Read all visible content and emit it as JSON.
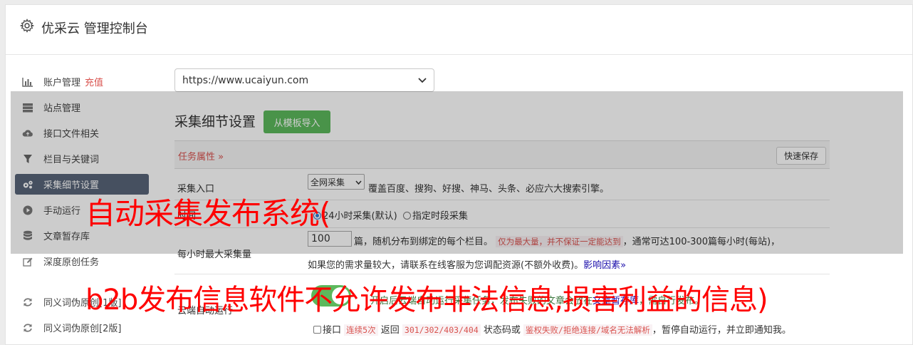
{
  "header": {
    "title": "优采云 管理控制台",
    "icon": "gear-icon"
  },
  "sidebar": {
    "items": [
      {
        "label": "账户管理",
        "extra": "充值",
        "icon": "bar-chart-icon"
      },
      {
        "label": "站点管理",
        "icon": "server-icon"
      },
      {
        "label": "接口文件相关",
        "icon": "cloud-upload-icon"
      },
      {
        "label": "栏目与关键词",
        "icon": "filter-icon"
      },
      {
        "label": "采集细节设置",
        "icon": "cogs-icon",
        "active": true
      },
      {
        "label": "手动运行",
        "icon": "play-circle-icon"
      },
      {
        "label": "文章暂存库",
        "icon": "database-icon"
      },
      {
        "label": "深度原创任务",
        "icon": "edit-icon"
      },
      {
        "label": "同义词伪原创[1版]",
        "icon": "refresh-icon"
      },
      {
        "label": "同义词伪原创[2版]",
        "icon": "refresh-icon"
      }
    ]
  },
  "site_select": {
    "value": "https://www.ucaiyun.com"
  },
  "main": {
    "section_title": "采集细节设置",
    "import_button": "从模板导入",
    "task_attr": "任务属性",
    "quick_save": "快速保存",
    "rows": {
      "entry": {
        "label": "采集入口",
        "select_value": "全网采集",
        "desc": "覆盖百度、搜狗、好搜、神马、头条、必应六大搜索引擎。"
      },
      "time": {
        "label": "时间",
        "opt1": "24小时采集(默认)",
        "opt2": "指定时段采集"
      },
      "max": {
        "label": "每小时最大采集量",
        "value": "100",
        "text1": "篇，随机分布到绑定的每个栏目。",
        "warn": "仅为最大量，并不保证一定能达到",
        "text2": "，通常可达100-300篇每小时(每站)，",
        "text3": "如果您的需求量较大，请联系在线客服为您调配资源(不额外收费)。",
        "link": "影响因素"
      },
      "cloud": {
        "label": "云端自动运行",
        "line1": "开启后云端自动运行采集任务，发布失败的文章会放在",
        "line1_link": "文章暂存库",
        "line1_end": "，需自行发布。",
        "api_label": "接口",
        "code1": "连续5次",
        "return_text": "返回",
        "code2": "301/302/403/404",
        "status_text": "状态码或",
        "code3": "鉴权失败/拒绝连接/域名无法解析",
        "line2_end": "，暂停自动运行，并立即通知我。"
      }
    }
  },
  "watermark": {
    "line1": "自动采集发布系统(",
    "line2": "b2b发布信息软件不允许发布非法信息,损害利益的信息)"
  },
  "colors": {
    "active_nav": "#586579",
    "green": "#5cb85c",
    "red": "#d9534f",
    "watermark": "#ff0000"
  }
}
